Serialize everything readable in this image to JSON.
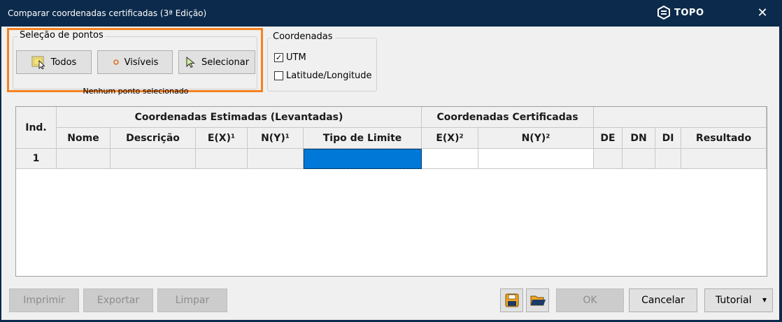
{
  "window": {
    "title": "Comparar coordenadas certificadas (3ª Edição)",
    "brand": "TOPO",
    "close_glyph": "✕"
  },
  "point_selection": {
    "legend": "Seleção de pontos",
    "buttons": [
      {
        "label": "Todos",
        "icon": "select-all-icon"
      },
      {
        "label": "Visíveis",
        "icon": "visible-points-icon"
      },
      {
        "label": "Selecionar",
        "icon": "pointer-select-icon"
      }
    ],
    "status": "Nenhum ponto selecionado"
  },
  "coordinates": {
    "legend": "Coordenadas",
    "options": [
      {
        "label": "UTM",
        "checked": true
      },
      {
        "label": "Latitude/Longitude",
        "checked": false
      }
    ]
  },
  "table": {
    "group_headers": {
      "index": "Ind.",
      "estimated": "Coordenadas Estimadas (Levantadas)",
      "certified": "Coordenadas Certificadas"
    },
    "columns": [
      "Nome",
      "Descrição",
      "E(X)¹",
      "N(Y)¹",
      "Tipo de Limite",
      "E(X)²",
      "N(Y)²",
      "DE",
      "DN",
      "DI",
      "Resultado"
    ],
    "rows": [
      {
        "index": "1",
        "cells": [
          "",
          "",
          "",
          "",
          "",
          "",
          "",
          "",
          "",
          "",
          ""
        ]
      }
    ]
  },
  "actions": {
    "print": "Imprimir",
    "export": "Exportar",
    "clear": "Limpar",
    "save_icon": "save-icon",
    "open_icon": "open-folder-icon",
    "ok": "OK",
    "cancel": "Cancelar",
    "tutorial": "Tutorial",
    "tutorial_arrow": "▾"
  },
  "colors": {
    "accent_orange": "#f58220",
    "selection_blue": "#0078d7",
    "titlebar": "#0c2a4b"
  }
}
